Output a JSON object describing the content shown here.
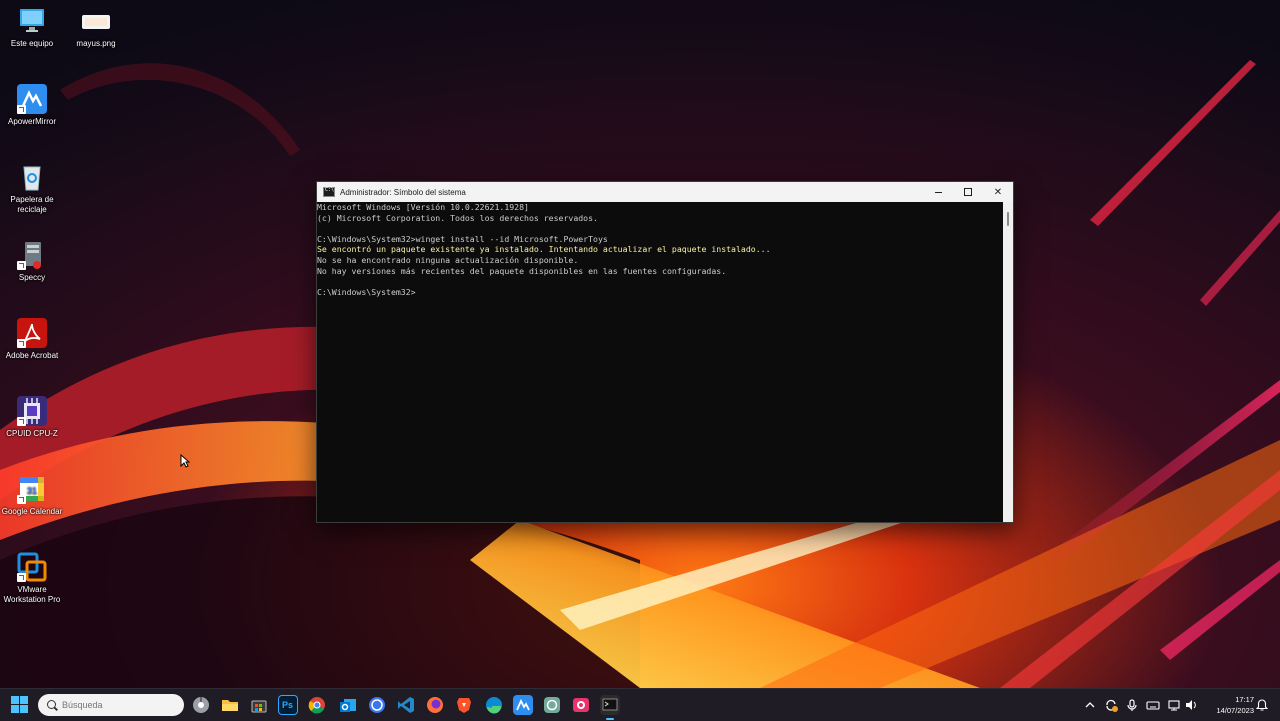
{
  "desktop": {
    "icons": [
      {
        "name": "desktop-icon-este-equipo",
        "label": "Este equipo",
        "glyph": "monitor-icon"
      },
      {
        "name": "desktop-icon-mayus",
        "label": "mayus.png",
        "glyph": "image-file-icon"
      },
      {
        "name": "desktop-icon-apowermirror",
        "label": "ApowerMirror",
        "glyph": "apowermirror-icon"
      },
      {
        "name": "desktop-icon-papelera",
        "label": "Papelera de reciclaje",
        "glyph": "recycle-bin-icon"
      },
      {
        "name": "desktop-icon-speccy",
        "label": "Speccy",
        "glyph": "speccy-icon"
      },
      {
        "name": "desktop-icon-acrobat",
        "label": "Adobe Acrobat",
        "glyph": "acrobat-icon"
      },
      {
        "name": "desktop-icon-cpuz",
        "label": "CPUID CPU-Z",
        "glyph": "cpuz-icon"
      },
      {
        "name": "desktop-icon-gcalendar",
        "label": "Google Calendar",
        "glyph": "calendar-icon"
      },
      {
        "name": "desktop-icon-vmware",
        "label": "VMware Workstation Pro",
        "glyph": "vmware-icon"
      }
    ]
  },
  "window": {
    "title": "Administrador: Símbolo del sistema",
    "console_lines": [
      "Microsoft Windows [Versión 10.0.22621.1928]",
      "(c) Microsoft Corporation. Todos los derechos reservados.",
      "",
      "C:\\Windows\\System32>winget install --id Microsoft.PowerToys",
      "Se encontró un paquete existente ya instalado. Intentando actualizar el paquete instalado...",
      "No se ha encontrado ninguna actualización disponible.",
      "No hay versiones más recientes del paquete disponibles en las fuentes configuradas.",
      "",
      "C:\\Windows\\System32>"
    ],
    "close_glyph": "✕"
  },
  "taskbar": {
    "search_placeholder": "Búsqueda",
    "apps": [
      "chrome-dev-icon",
      "file-explorer-icon",
      "microsoft-store-icon",
      "photoshop-icon",
      "chrome-icon",
      "outlook-icon",
      "signal-icon",
      "vscode-icon",
      "firefox-icon",
      "brave-icon",
      "edge-icon",
      "apowermirror-icon",
      "chatgpt-icon",
      "snip-icon",
      "terminal-icon"
    ],
    "photoshop_label": "Ps",
    "time": "17:17",
    "date": "14/07/2023"
  },
  "colors": {
    "accent": "#4cc2ff",
    "console_bg": "#0c0c0c",
    "console_text": "#cccccc",
    "console_warning": "#f9f1a5"
  }
}
